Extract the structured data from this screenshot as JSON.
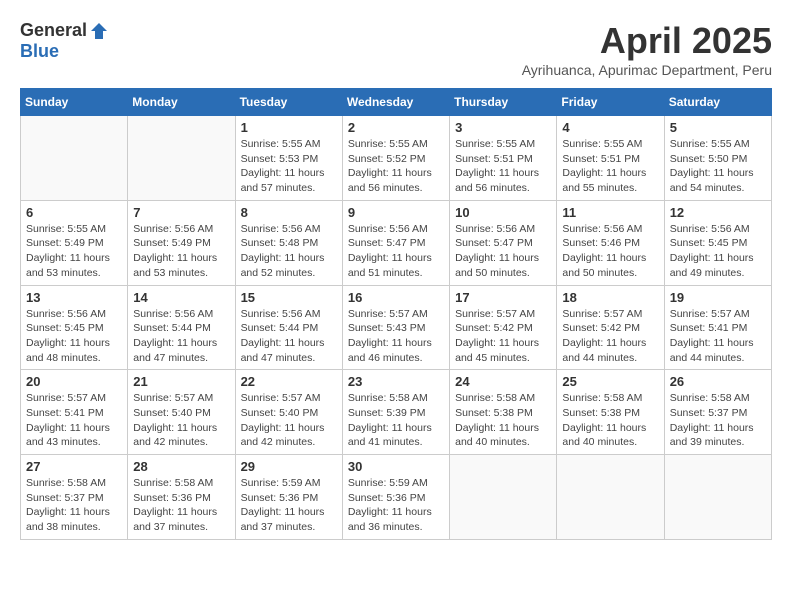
{
  "header": {
    "logo_general": "General",
    "logo_blue": "Blue",
    "month_title": "April 2025",
    "location": "Ayrihuanca, Apurimac Department, Peru"
  },
  "days_of_week": [
    "Sunday",
    "Monday",
    "Tuesday",
    "Wednesday",
    "Thursday",
    "Friday",
    "Saturday"
  ],
  "weeks": [
    [
      {
        "day": "",
        "info": ""
      },
      {
        "day": "",
        "info": ""
      },
      {
        "day": "1",
        "info": "Sunrise: 5:55 AM\nSunset: 5:53 PM\nDaylight: 11 hours and 57 minutes."
      },
      {
        "day": "2",
        "info": "Sunrise: 5:55 AM\nSunset: 5:52 PM\nDaylight: 11 hours and 56 minutes."
      },
      {
        "day": "3",
        "info": "Sunrise: 5:55 AM\nSunset: 5:51 PM\nDaylight: 11 hours and 56 minutes."
      },
      {
        "day": "4",
        "info": "Sunrise: 5:55 AM\nSunset: 5:51 PM\nDaylight: 11 hours and 55 minutes."
      },
      {
        "day": "5",
        "info": "Sunrise: 5:55 AM\nSunset: 5:50 PM\nDaylight: 11 hours and 54 minutes."
      }
    ],
    [
      {
        "day": "6",
        "info": "Sunrise: 5:55 AM\nSunset: 5:49 PM\nDaylight: 11 hours and 53 minutes."
      },
      {
        "day": "7",
        "info": "Sunrise: 5:56 AM\nSunset: 5:49 PM\nDaylight: 11 hours and 53 minutes."
      },
      {
        "day": "8",
        "info": "Sunrise: 5:56 AM\nSunset: 5:48 PM\nDaylight: 11 hours and 52 minutes."
      },
      {
        "day": "9",
        "info": "Sunrise: 5:56 AM\nSunset: 5:47 PM\nDaylight: 11 hours and 51 minutes."
      },
      {
        "day": "10",
        "info": "Sunrise: 5:56 AM\nSunset: 5:47 PM\nDaylight: 11 hours and 50 minutes."
      },
      {
        "day": "11",
        "info": "Sunrise: 5:56 AM\nSunset: 5:46 PM\nDaylight: 11 hours and 50 minutes."
      },
      {
        "day": "12",
        "info": "Sunrise: 5:56 AM\nSunset: 5:45 PM\nDaylight: 11 hours and 49 minutes."
      }
    ],
    [
      {
        "day": "13",
        "info": "Sunrise: 5:56 AM\nSunset: 5:45 PM\nDaylight: 11 hours and 48 minutes."
      },
      {
        "day": "14",
        "info": "Sunrise: 5:56 AM\nSunset: 5:44 PM\nDaylight: 11 hours and 47 minutes."
      },
      {
        "day": "15",
        "info": "Sunrise: 5:56 AM\nSunset: 5:44 PM\nDaylight: 11 hours and 47 minutes."
      },
      {
        "day": "16",
        "info": "Sunrise: 5:57 AM\nSunset: 5:43 PM\nDaylight: 11 hours and 46 minutes."
      },
      {
        "day": "17",
        "info": "Sunrise: 5:57 AM\nSunset: 5:42 PM\nDaylight: 11 hours and 45 minutes."
      },
      {
        "day": "18",
        "info": "Sunrise: 5:57 AM\nSunset: 5:42 PM\nDaylight: 11 hours and 44 minutes."
      },
      {
        "day": "19",
        "info": "Sunrise: 5:57 AM\nSunset: 5:41 PM\nDaylight: 11 hours and 44 minutes."
      }
    ],
    [
      {
        "day": "20",
        "info": "Sunrise: 5:57 AM\nSunset: 5:41 PM\nDaylight: 11 hours and 43 minutes."
      },
      {
        "day": "21",
        "info": "Sunrise: 5:57 AM\nSunset: 5:40 PM\nDaylight: 11 hours and 42 minutes."
      },
      {
        "day": "22",
        "info": "Sunrise: 5:57 AM\nSunset: 5:40 PM\nDaylight: 11 hours and 42 minutes."
      },
      {
        "day": "23",
        "info": "Sunrise: 5:58 AM\nSunset: 5:39 PM\nDaylight: 11 hours and 41 minutes."
      },
      {
        "day": "24",
        "info": "Sunrise: 5:58 AM\nSunset: 5:38 PM\nDaylight: 11 hours and 40 minutes."
      },
      {
        "day": "25",
        "info": "Sunrise: 5:58 AM\nSunset: 5:38 PM\nDaylight: 11 hours and 40 minutes."
      },
      {
        "day": "26",
        "info": "Sunrise: 5:58 AM\nSunset: 5:37 PM\nDaylight: 11 hours and 39 minutes."
      }
    ],
    [
      {
        "day": "27",
        "info": "Sunrise: 5:58 AM\nSunset: 5:37 PM\nDaylight: 11 hours and 38 minutes."
      },
      {
        "day": "28",
        "info": "Sunrise: 5:58 AM\nSunset: 5:36 PM\nDaylight: 11 hours and 37 minutes."
      },
      {
        "day": "29",
        "info": "Sunrise: 5:59 AM\nSunset: 5:36 PM\nDaylight: 11 hours and 37 minutes."
      },
      {
        "day": "30",
        "info": "Sunrise: 5:59 AM\nSunset: 5:36 PM\nDaylight: 11 hours and 36 minutes."
      },
      {
        "day": "",
        "info": ""
      },
      {
        "day": "",
        "info": ""
      },
      {
        "day": "",
        "info": ""
      }
    ]
  ]
}
